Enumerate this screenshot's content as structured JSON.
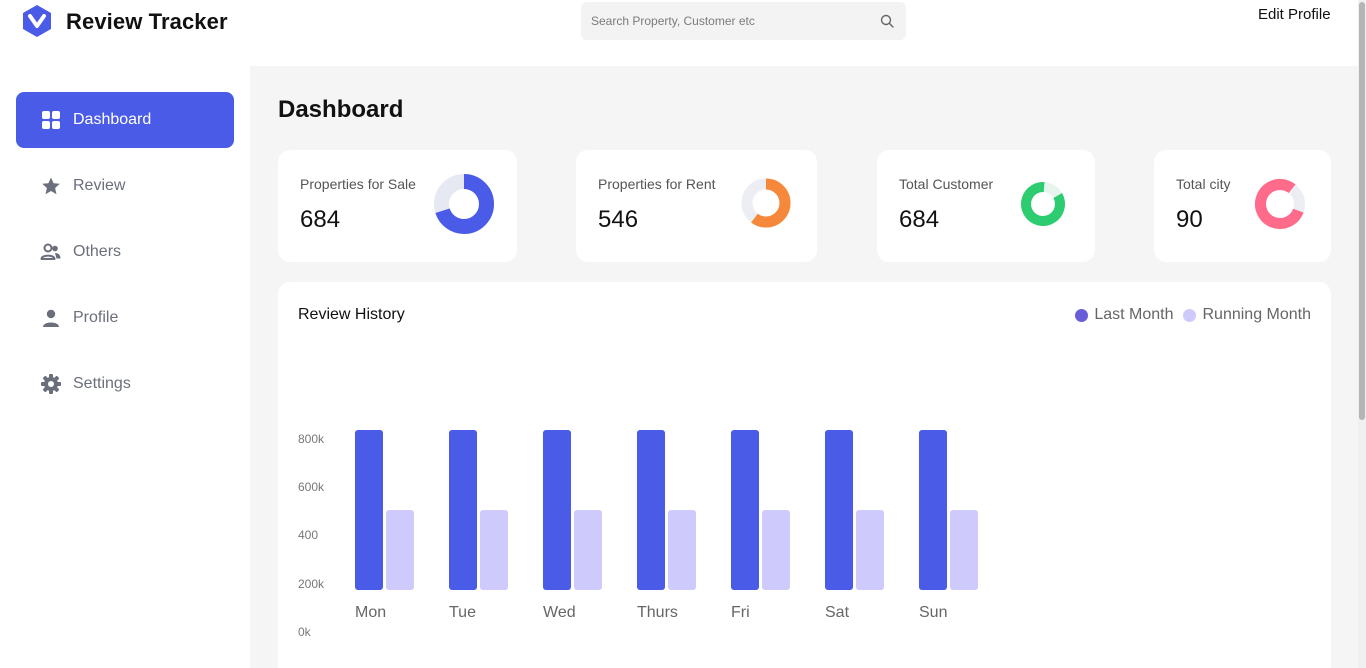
{
  "header": {
    "brand": "Review Tracker",
    "search_placeholder": "Search Property, Customer etc",
    "edit_profile": "Edit Profile"
  },
  "sidebar": {
    "items": [
      {
        "label": "Dashboard",
        "icon": "grid-icon",
        "active": true
      },
      {
        "label": "Review",
        "icon": "star-icon",
        "active": false
      },
      {
        "label": "Others",
        "icon": "users-icon",
        "active": false
      },
      {
        "label": "Profile",
        "icon": "person-icon",
        "active": false
      },
      {
        "label": "Settings",
        "icon": "gear-icon",
        "active": false
      }
    ]
  },
  "main": {
    "title": "Dashboard",
    "stats": [
      {
        "label": "Properties for Sale",
        "value": "684",
        "color": "#4a5be8"
      },
      {
        "label": "Properties for Rent",
        "value": "546",
        "color": "#f5883a"
      },
      {
        "label": "Total Customer",
        "value": "684",
        "color": "#2ecc71"
      },
      {
        "label": "Total city",
        "value": "90",
        "color": "#ff6b8a"
      }
    ]
  },
  "colors": {
    "accent": "#4a5be8",
    "last_month": "#4a5be8",
    "running_month": "#cfcafc",
    "legend_last_month": "#6a5ed8"
  },
  "chart_data": {
    "type": "bar",
    "title": "Review History",
    "categories": [
      "Mon",
      "Tue",
      "Wed",
      "Thurs",
      "Fri",
      "Sat",
      "Sun"
    ],
    "y_tick_labels": [
      "0k",
      "200k",
      "400",
      "600k",
      "800k"
    ],
    "series": [
      {
        "name": "Last Month",
        "values": [
          800000,
          800000,
          800000,
          800000,
          800000,
          800000,
          800000
        ]
      },
      {
        "name": "Running Month",
        "values": [
          400000,
          400000,
          400000,
          400000,
          400000,
          400000,
          400000
        ]
      }
    ],
    "ylim": [
      0,
      800000
    ],
    "legend_position": "top-right",
    "grid": false
  }
}
